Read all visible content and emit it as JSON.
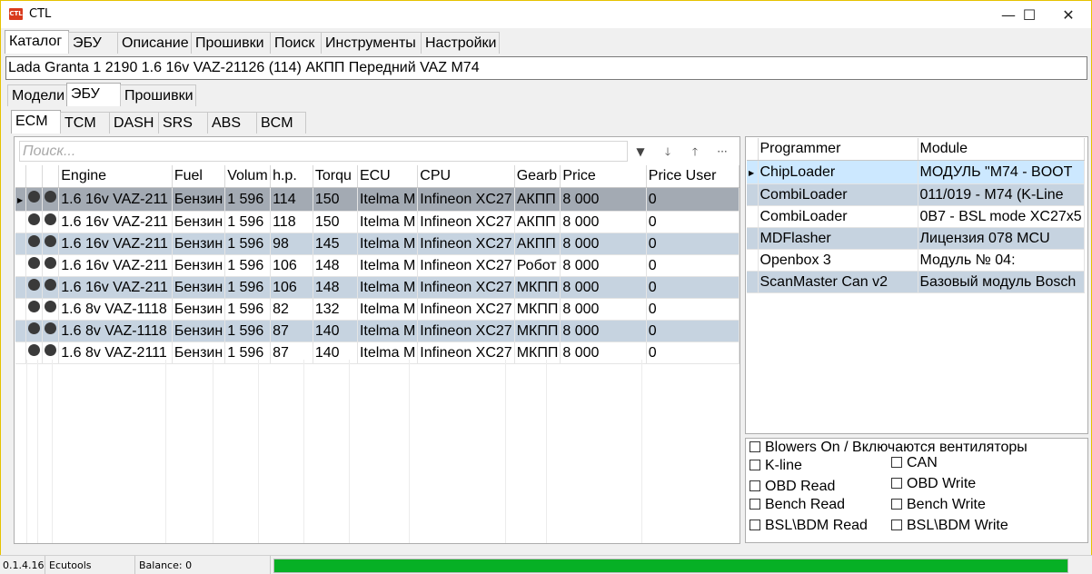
{
  "app": {
    "icon_text": "CTL",
    "title": "CTL"
  },
  "window_controls": {
    "minimize": "—",
    "maximize": "☐",
    "close": "✕"
  },
  "main_tabs": [
    "Каталог",
    "ЭБУ",
    "Описание",
    "Прошивки",
    "Поиск",
    "Инструменты",
    "Настройки"
  ],
  "car_description": "Lada Granta 1 2190 1.6 16v VAZ-21126 (114) АКПП Передний VAZ M74",
  "sub_tabs": [
    "Модели",
    "ЭБУ",
    "Прошивки"
  ],
  "ecu_tabs": [
    "ECM",
    "TCM",
    "DASH",
    "SRS",
    "ABS",
    "BCM"
  ],
  "search": {
    "placeholder": "Поиск..."
  },
  "toolbar_icons": [
    "filter-icon",
    "sort-descending-icon",
    "sort-ascending-icon",
    "more-icon"
  ],
  "toolbar_glyphs": {
    "filter": "▼",
    "down": "🡓",
    "up": "🡑",
    "more": "···"
  },
  "ecu_table": {
    "columns": [
      "Engine",
      "Fuel",
      "Volum",
      "h.p.",
      "Torqu",
      "ECU",
      "CPU",
      "Gearb",
      "Price",
      "Price User"
    ],
    "rows": [
      [
        "1.6 16v VAZ-211",
        "Бензин",
        "1 596",
        "114",
        "150",
        "Itelma M",
        "Infineon XC27",
        "АКПП",
        "8 000",
        "0"
      ],
      [
        "1.6 16v VAZ-211",
        "Бензин",
        "1 596",
        "118",
        "150",
        "Itelma M",
        "Infineon XC27",
        "АКПП",
        "8 000",
        "0"
      ],
      [
        "1.6 16v VAZ-211",
        "Бензин",
        "1 596",
        "98",
        "145",
        "Itelma M",
        "Infineon XC27",
        "АКПП",
        "8 000",
        "0"
      ],
      [
        "1.6 16v VAZ-211",
        "Бензин",
        "1 596",
        "106",
        "148",
        "Itelma M",
        "Infineon XC27",
        "Робот",
        "8 000",
        "0"
      ],
      [
        "1.6 16v VAZ-211",
        "Бензин",
        "1 596",
        "106",
        "148",
        "Itelma M",
        "Infineon XC27",
        "МКПП",
        "8 000",
        "0"
      ],
      [
        "1.6 8v VAZ-1118",
        "Бензин",
        "1 596",
        "82",
        "132",
        "Itelma M",
        "Infineon XC27",
        "МКПП",
        "8 000",
        "0"
      ],
      [
        "1.6 8v VAZ-1118",
        "Бензин",
        "1 596",
        "87",
        "140",
        "Itelma M",
        "Infineon XC27",
        "МКПП",
        "8 000",
        "0"
      ],
      [
        "1.6 8v VAZ-2111",
        "Бензин",
        "1 596",
        "87",
        "140",
        "Itelma M",
        "Infineon XC27",
        "МКПП",
        "8 000",
        "0"
      ]
    ]
  },
  "programmer_table": {
    "columns": [
      "Programmer",
      "Module"
    ],
    "rows": [
      [
        "ChipLoader",
        "МОДУЛЬ \"M74 - BOOT"
      ],
      [
        "CombiLoader",
        "011/019 - M74 (K-Line"
      ],
      [
        "CombiLoader",
        "0B7 - BSL mode XC27x5"
      ],
      [
        "MDFlasher",
        "Лицензия 078 MCU"
      ],
      [
        "Openbox 3",
        "Модуль № 04:"
      ],
      [
        "ScanMaster Can v2",
        "Базовый модуль Bosch"
      ]
    ]
  },
  "options": {
    "blowers": "Blowers On / Включаются вентиляторы",
    "kline": "K-line",
    "can": "CAN",
    "obd_read": "OBD Read",
    "obd_write": "OBD Write",
    "bench_read": "Bench Read",
    "bench_write": "Bench Write",
    "bsl_read": "BSL\\BDM Read",
    "bsl_write": "BSL\\BDM Write"
  },
  "status": {
    "version": "0.1.4.16",
    "app_name": "Ecutools",
    "balance": "Balance: 0",
    "progress_fraction": 1.0
  },
  "colors": {
    "selected_row": "#a3aab3",
    "alt_row": "#c6d3e0",
    "highlight_row": "#cce8ff",
    "progress": "#06b025",
    "window_border": "#e6c200"
  }
}
